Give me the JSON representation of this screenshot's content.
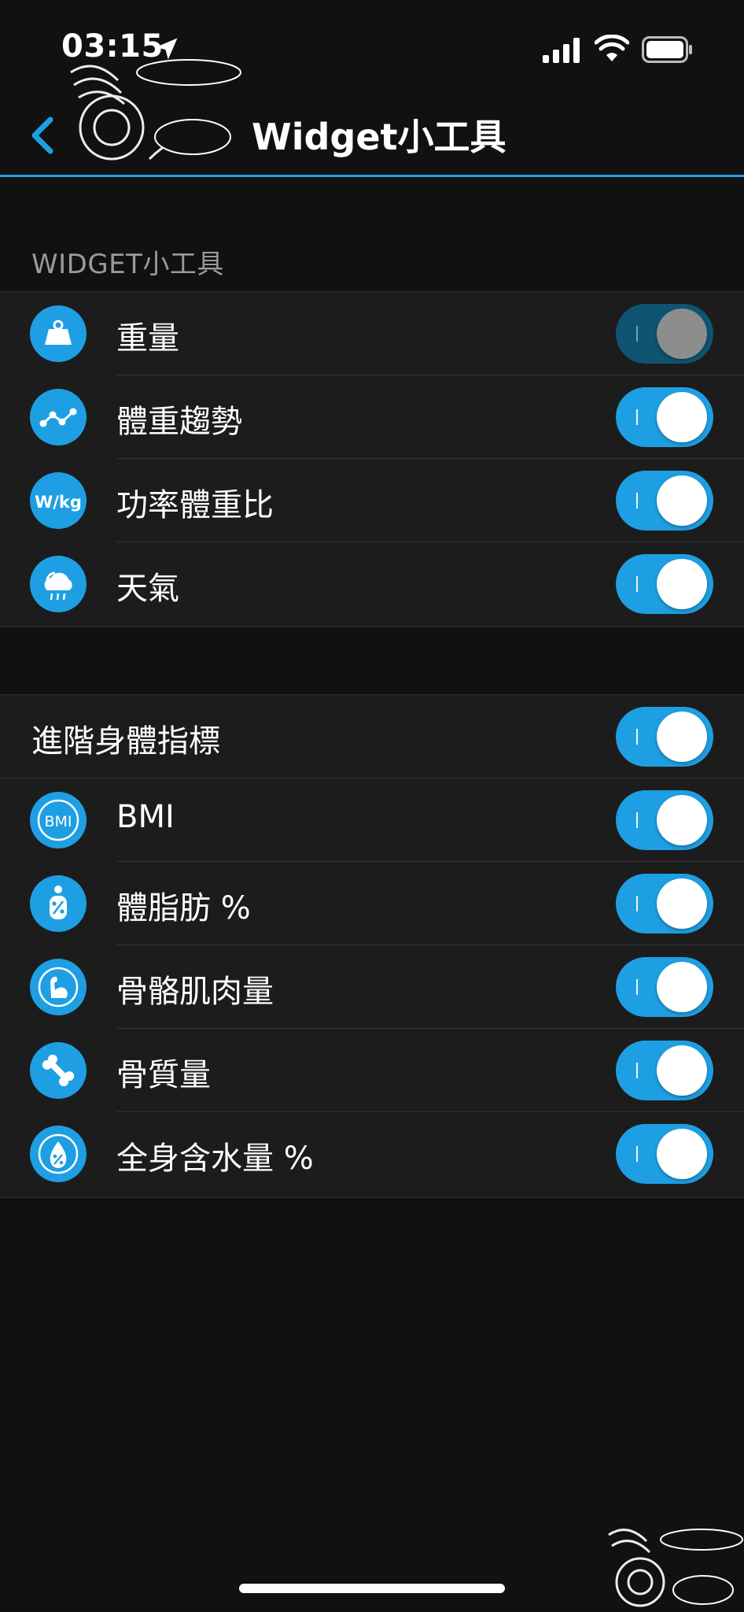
{
  "status_bar": {
    "time": "03:15"
  },
  "nav": {
    "title": "Widget小工具"
  },
  "section_header": "WIDGET小工具",
  "widgets": [
    {
      "label": "重量",
      "icon": "scale-weight-icon",
      "state": "dimmed"
    },
    {
      "label": "體重趨勢",
      "icon": "trend-chart-icon",
      "state": "on"
    },
    {
      "label": "功率體重比",
      "icon": "wkg-icon",
      "icon_text": "W/kg",
      "state": "on"
    },
    {
      "label": "天氣",
      "icon": "weather-icon",
      "state": "on"
    }
  ],
  "advanced": {
    "master_label": "進階身體指標",
    "items": [
      {
        "label": "BMI",
        "icon": "bmi-icon",
        "icon_text": "BMI",
        "state": "on"
      },
      {
        "label": "體脂肪 %",
        "icon": "body-fat-icon",
        "state": "on"
      },
      {
        "label": "骨骼肌肉量",
        "icon": "muscle-icon",
        "state": "on"
      },
      {
        "label": "骨質量",
        "icon": "bone-icon",
        "state": "on"
      },
      {
        "label": "全身含水量 %",
        "icon": "water-drop-icon",
        "state": "on"
      }
    ]
  },
  "colors": {
    "accent": "#1e9fe3",
    "background": "#111111",
    "row_background": "#1c1c1c",
    "toggle_dimmed": "#0f5472"
  }
}
